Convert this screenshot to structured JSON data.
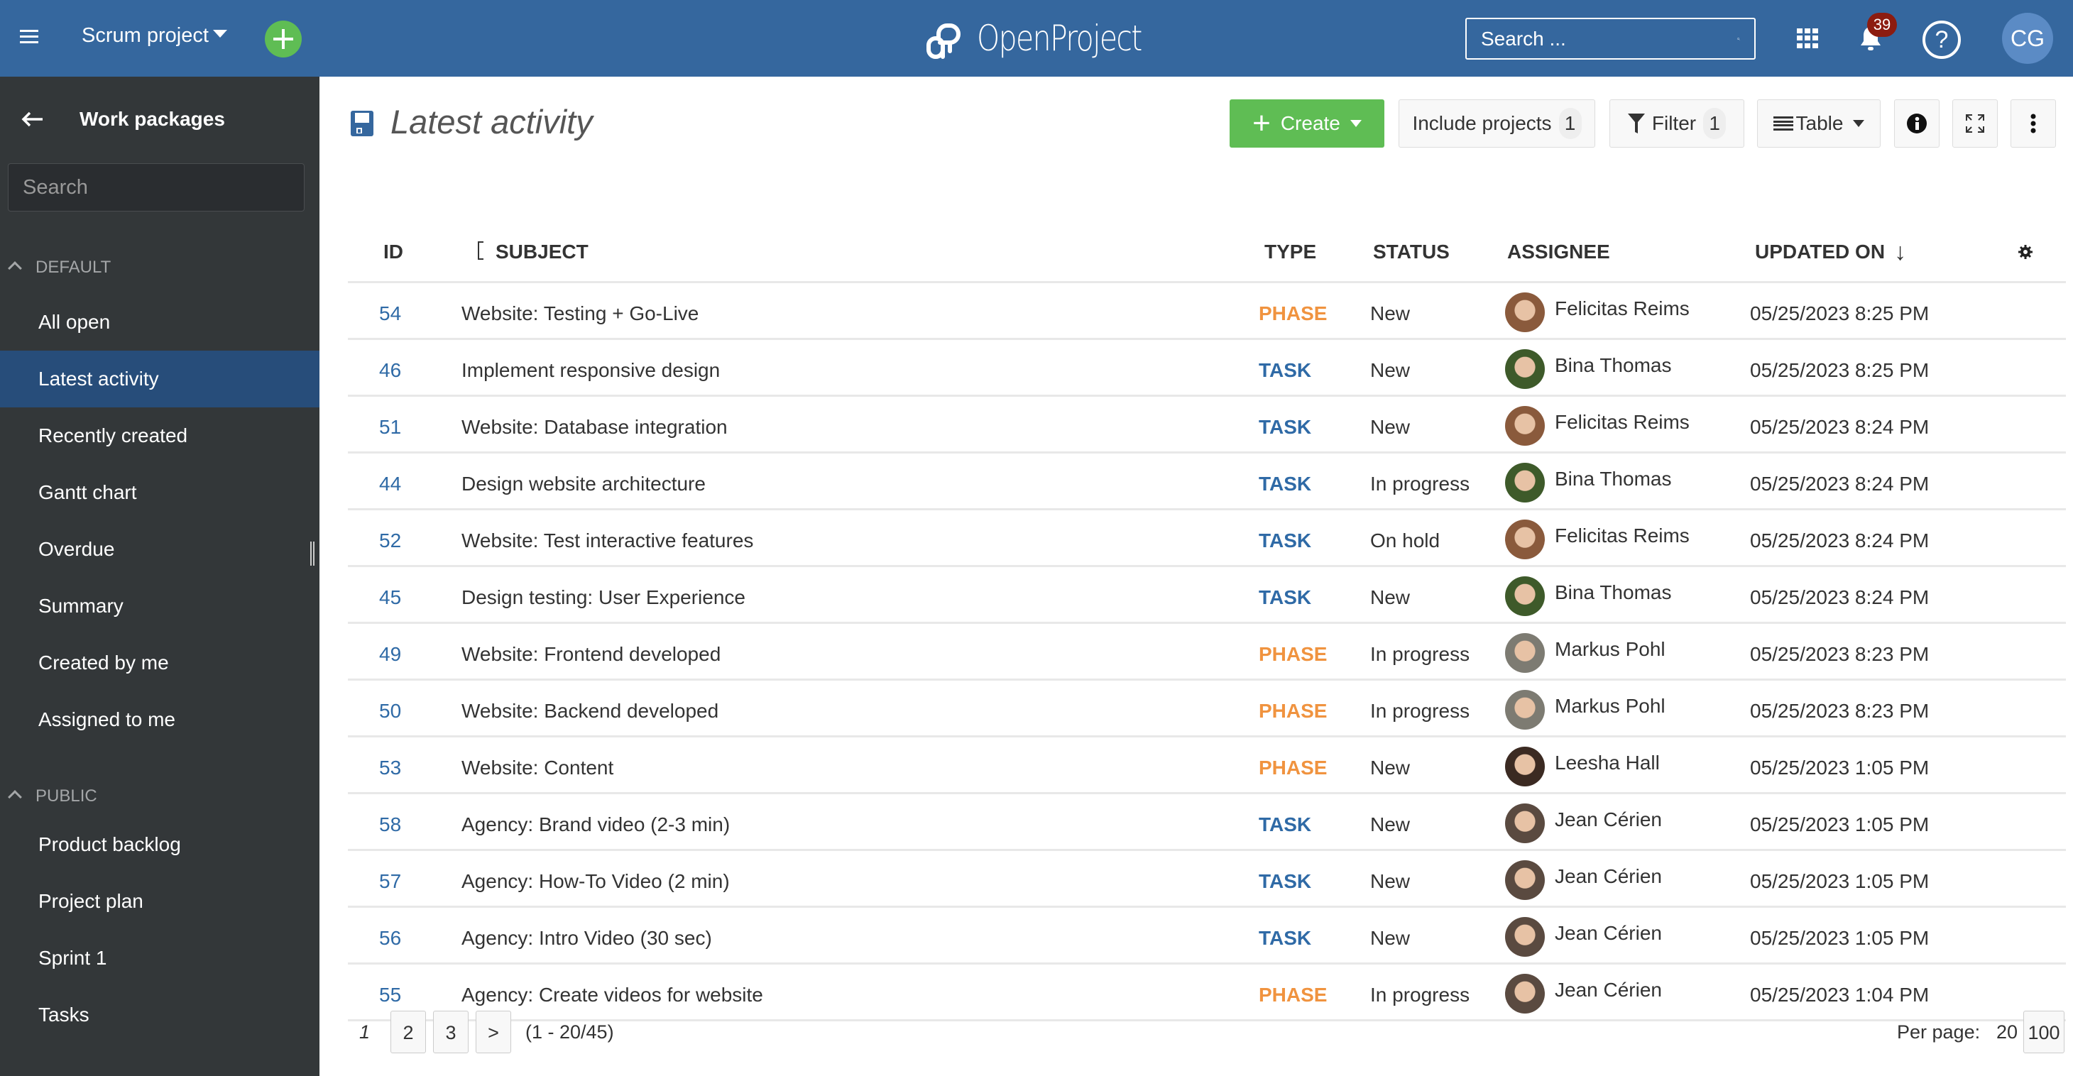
{
  "header": {
    "project_name": "Scrum project",
    "logo_text": "OpenProject",
    "search_placeholder": "Search ...",
    "notification_count": "39",
    "help_label": "?",
    "user_initials": "CG",
    "colors": {
      "header_bg": "#35679e",
      "add_button": "#5fbd54",
      "badge": "#8c1c10",
      "avatar_bg": "#5b8bc5"
    }
  },
  "sidebar": {
    "title": "Work packages",
    "search_placeholder": "Search",
    "sections": [
      {
        "label": "DEFAULT",
        "items": [
          {
            "label": "All open"
          },
          {
            "label": "Latest activity",
            "active": true
          },
          {
            "label": "Recently created"
          },
          {
            "label": "Gantt chart"
          },
          {
            "label": "Overdue"
          },
          {
            "label": "Summary"
          },
          {
            "label": "Created by me"
          },
          {
            "label": "Assigned to me"
          }
        ]
      },
      {
        "label": "PUBLIC",
        "items": [
          {
            "label": "Product backlog"
          },
          {
            "label": "Project plan"
          },
          {
            "label": "Sprint 1"
          },
          {
            "label": "Tasks"
          }
        ]
      }
    ],
    "colors": {
      "bg": "#333739",
      "active_bg": "#274d7a"
    }
  },
  "main": {
    "title": "Latest activity",
    "toolbar": {
      "create_label": "Create",
      "include_projects_label": "Include projects",
      "include_projects_count": "1",
      "filter_label": "Filter",
      "filter_count": "1",
      "view_label": "Table"
    },
    "table": {
      "columns": [
        "ID",
        "SUBJECT",
        "TYPE",
        "STATUS",
        "ASSIGNEE",
        "UPDATED ON"
      ],
      "sort_indicator": "↓",
      "rows": [
        {
          "id": "54",
          "subject": "Website: Testing + Go-Live",
          "type": "PHASE",
          "status": "New",
          "assignee": "Felicitas Reims",
          "updated": "05/25/2023 8:25 PM"
        },
        {
          "id": "46",
          "subject": "Implement responsive design",
          "type": "TASK",
          "status": "New",
          "assignee": "Bina Thomas",
          "updated": "05/25/2023 8:25 PM"
        },
        {
          "id": "51",
          "subject": "Website: Database integration",
          "type": "TASK",
          "status": "New",
          "assignee": "Felicitas Reims",
          "updated": "05/25/2023 8:24 PM"
        },
        {
          "id": "44",
          "subject": "Design website architecture",
          "type": "TASK",
          "status": "In progress",
          "assignee": "Bina Thomas",
          "updated": "05/25/2023 8:24 PM"
        },
        {
          "id": "52",
          "subject": "Website: Test interactive features",
          "type": "TASK",
          "status": "On hold",
          "assignee": "Felicitas Reims",
          "updated": "05/25/2023 8:24 PM"
        },
        {
          "id": "45",
          "subject": "Design testing: User Experience",
          "type": "TASK",
          "status": "New",
          "assignee": "Bina Thomas",
          "updated": "05/25/2023 8:24 PM"
        },
        {
          "id": "49",
          "subject": "Website: Frontend developed",
          "type": "PHASE",
          "status": "In progress",
          "assignee": "Markus Pohl",
          "updated": "05/25/2023 8:23 PM"
        },
        {
          "id": "50",
          "subject": "Website: Backend developed",
          "type": "PHASE",
          "status": "In progress",
          "assignee": "Markus Pohl",
          "updated": "05/25/2023 8:23 PM"
        },
        {
          "id": "53",
          "subject": "Website: Content",
          "type": "PHASE",
          "status": "New",
          "assignee": "Leesha Hall",
          "updated": "05/25/2023 1:05 PM"
        },
        {
          "id": "58",
          "subject": "Agency: Brand video (2-3 min)",
          "type": "TASK",
          "status": "New",
          "assignee": "Jean Cérien",
          "updated": "05/25/2023 1:05 PM"
        },
        {
          "id": "57",
          "subject": "Agency: How-To Video (2 min)",
          "type": "TASK",
          "status": "New",
          "assignee": "Jean Cérien",
          "updated": "05/25/2023 1:05 PM"
        },
        {
          "id": "56",
          "subject": "Agency: Intro Video (30 sec)",
          "type": "TASK",
          "status": "New",
          "assignee": "Jean Cérien",
          "updated": "05/25/2023 1:05 PM"
        },
        {
          "id": "55",
          "subject": "Agency: Create videos for website",
          "type": "PHASE",
          "status": "In progress",
          "assignee": "Jean Cérien",
          "updated": "05/25/2023 1:04 PM"
        }
      ],
      "type_colors": {
        "PHASE": "#f0933f",
        "TASK": "#2f6aa6"
      },
      "avatar_colors": {
        "Felicitas Reims": "#8a5a3c",
        "Bina Thomas": "#3e5a2a",
        "Markus Pohl": "#7d7b72",
        "Leesha Hall": "#3b2a22",
        "Jean Cérien": "#5a4a40"
      }
    },
    "pagination": {
      "current": "1",
      "pages": [
        "2",
        "3"
      ],
      "next": ">",
      "range": "(1 - 20/45)",
      "per_page_label": "Per page:",
      "per_page_options": [
        "20",
        "100"
      ]
    }
  }
}
